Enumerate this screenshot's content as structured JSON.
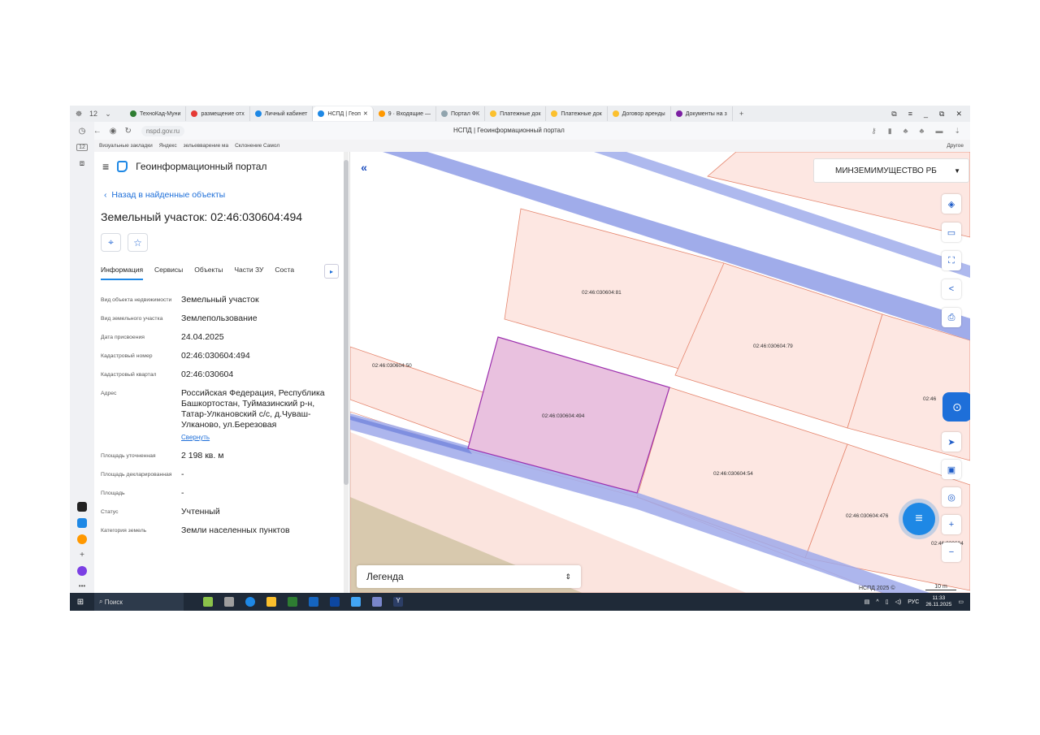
{
  "browser": {
    "tabs": [
      {
        "label": "ТехноКад-Муни",
        "color": "#2e7d32"
      },
      {
        "label": "размещение отх",
        "color": "#e53935"
      },
      {
        "label": "Личный кабинет",
        "color": "#1e88e5"
      },
      {
        "label": "НСПД | Геоп",
        "color": "#1e88e5",
        "active": true
      },
      {
        "label": "9 · Входящие —",
        "color": "#ff9800"
      },
      {
        "label": "Портал ФК",
        "color": "#90a4ae"
      },
      {
        "label": "Платежные док",
        "color": "#fbc02d"
      },
      {
        "label": "Платежные док",
        "color": "#fbc02d"
      },
      {
        "label": "Договор аренды",
        "color": "#fbc02d"
      },
      {
        "label": "Документы на з",
        "color": "#7b1fa2"
      }
    ],
    "url": "nspd.gov.ru",
    "page_title": "НСПД | Геоинформационный портал",
    "bookmarks": [
      "Визуальные закладки",
      "Яндекс",
      "зельевварение ма",
      "Склонение Самол"
    ],
    "bookmarks_other": "Другое",
    "sidebar_badge": "12"
  },
  "panel": {
    "app_title": "Геоинформационный портал",
    "back_label": "Назад в найденные объекты",
    "title": "Земельный участок: 02:46:030604:494",
    "tabs": [
      "Информация",
      "Сервисы",
      "Объекты",
      "Части ЗУ",
      "Соста"
    ],
    "rows": [
      {
        "key": "Вид объекта недвижимости",
        "value": "Земельный участок"
      },
      {
        "key": "Вид земельного участка",
        "value": "Землепользование"
      },
      {
        "key": "Дата присвоения",
        "value": "24.04.2025"
      },
      {
        "key": "Кадастровый номер",
        "value": "02:46:030604:494"
      },
      {
        "key": "Кадастровый квартал",
        "value": "02:46:030604"
      },
      {
        "key": "Адрес",
        "value": "Российская Федерация, Республика Башкортостан, Туймазинский р-н, Татар-Улкановский с/с, д.Чуваш-Улканово, ул.Березовая",
        "link": "Свернуть"
      },
      {
        "key": "Площадь уточненная",
        "value": "2 198 кв. м"
      },
      {
        "key": "Площадь декларированная",
        "value": "-"
      },
      {
        "key": "Площадь",
        "value": "-"
      },
      {
        "key": "Статус",
        "value": "Учтенный"
      },
      {
        "key": "Категория земель",
        "value": "Земли населенных пунктов"
      }
    ]
  },
  "map": {
    "region": "МИНЗЕМИМУЩЕСТВО РБ",
    "legend": "Легенда",
    "copyright": "НСПД 2025 ©",
    "scale": "10 m",
    "parcels": [
      {
        "id": "p81",
        "label": "02:46:030604:81"
      },
      {
        "id": "p79",
        "label": "02:46:030604:79"
      },
      {
        "id": "p50",
        "label": "02:46:030604:50"
      },
      {
        "id": "p494",
        "label": "02:46:030604:494"
      },
      {
        "id": "p54",
        "label": "02:46:030604:54"
      },
      {
        "id": "p476",
        "label": "02:46:030604:476"
      },
      {
        "id": "p46a",
        "label": "02:46"
      },
      {
        "id": "p46b",
        "label": "02:46:030604"
      }
    ],
    "colors": {
      "parcel_fill": "#fdeae6",
      "parcel_stroke": "#e5866e",
      "selected_fill": "#e9c1df",
      "selected_stroke": "#9c2fae",
      "road": "#8f9ee6"
    }
  },
  "taskbar": {
    "search": "Поиск",
    "lang": "РУС",
    "time": "11:33",
    "date": "26.11.2025"
  }
}
